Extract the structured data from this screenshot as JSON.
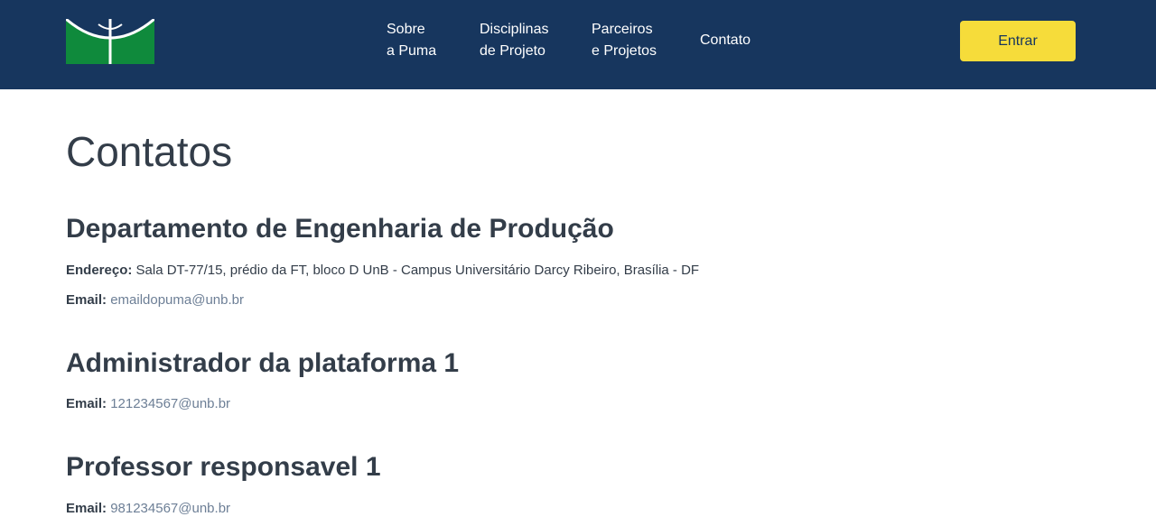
{
  "header": {
    "logo_name": "unb-logo",
    "nav": [
      {
        "label": "Sobre\na Puma"
      },
      {
        "label": "Disciplinas\nde Projeto"
      },
      {
        "label": "Parceiros\ne Projetos"
      },
      {
        "label": "Contato"
      }
    ],
    "enter_label": "Entrar",
    "colors": {
      "background": "#17365e",
      "button": "#f6dc3a"
    }
  },
  "main": {
    "title": "Contatos",
    "sections": [
      {
        "title": "Departamento de Engenharia de Produção",
        "address_label": "Endereço:",
        "address": "Sala DT-77/15, prédio da FT, bloco D UnB - Campus Universitário Darcy Ribeiro, Brasília - DF",
        "email_label": "Email:",
        "email": "emaildopuma@unb.br"
      },
      {
        "title": "Administrador da plataforma 1",
        "email_label": "Email:",
        "email": "121234567@unb.br"
      },
      {
        "title": "Professor responsavel 1",
        "email_label": "Email:",
        "email": "981234567@unb.br"
      }
    ]
  }
}
